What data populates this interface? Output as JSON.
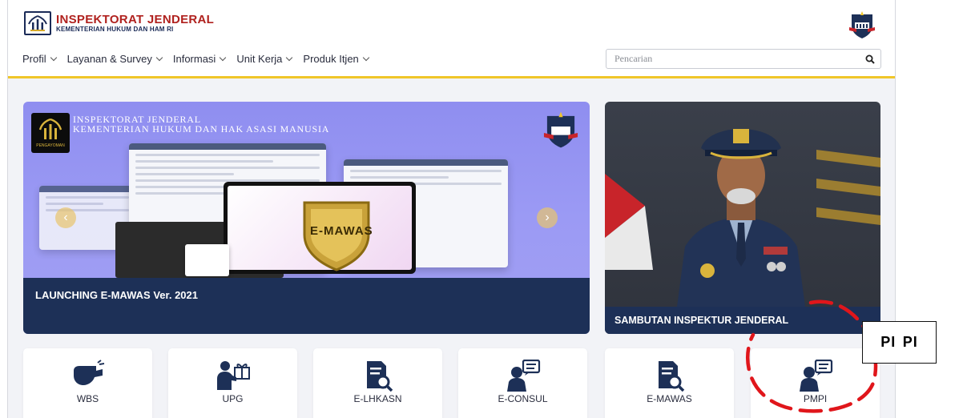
{
  "header": {
    "org_title": "INSPEKTORAT JENDERAL",
    "org_subtitle": "KEMENTERIAN HUKUM DAN HAM RI"
  },
  "nav": {
    "items": [
      {
        "label": "Profil"
      },
      {
        "label": "Layanan & Survey"
      },
      {
        "label": "Informasi"
      },
      {
        "label": "Unit Kerja"
      },
      {
        "label": "Produk Itjen"
      }
    ]
  },
  "search": {
    "placeholder": "Pencarian",
    "icon": "search-icon"
  },
  "slider": {
    "org_line1": "INSPEKTORAT JENDERAL",
    "org_line2": "KEMENTERIAN HUKUM DAN HAK ASASI MANUSIA",
    "logo_text": "PENGAYOMAN",
    "shield_label": "E-MAWAS",
    "caption": "LAUNCHING E-MAWAS Ver. 2021"
  },
  "portrait": {
    "caption": "SAMBUTAN INSPEKTUR JENDERAL"
  },
  "services": [
    {
      "label": "WBS",
      "icon": "whistle-icon"
    },
    {
      "label": "UPG",
      "icon": "person-gift-icon"
    },
    {
      "label": "E-LHKASN",
      "icon": "document-search-icon"
    },
    {
      "label": "E-CONSUL",
      "icon": "person-chat-icon"
    },
    {
      "label": "E-MAWAS",
      "icon": "document-search-icon"
    },
    {
      "label": "PMPI",
      "icon": "person-chat-icon"
    }
  ],
  "annotation": {
    "label": "PI  PI",
    "color": "#e0161b"
  },
  "colors": {
    "navy": "#1d3057",
    "gold": "#f0c629",
    "brand_red": "#b0211e",
    "slider_purple": "#9b9af4"
  }
}
